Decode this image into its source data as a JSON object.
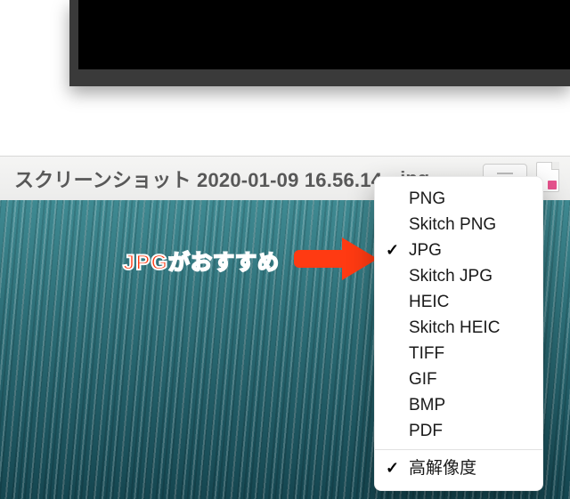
{
  "toolbar": {
    "filename": "スクリーンショット 2020-01-09 16.56.14",
    "extension": ".jpg"
  },
  "annotation": {
    "text": "JPGがおすすめ"
  },
  "format_menu": {
    "items": [
      {
        "label": "PNG",
        "checked": false
      },
      {
        "label": "Skitch PNG",
        "checked": false
      },
      {
        "label": "JPG",
        "checked": true
      },
      {
        "label": "Skitch JPG",
        "checked": false
      },
      {
        "label": "HEIC",
        "checked": false
      },
      {
        "label": "Skitch HEIC",
        "checked": false
      },
      {
        "label": "TIFF",
        "checked": false
      },
      {
        "label": "GIF",
        "checked": false
      },
      {
        "label": "BMP",
        "checked": false
      },
      {
        "label": "PDF",
        "checked": false
      }
    ],
    "resolution": {
      "label": "高解像度",
      "checked": true
    }
  }
}
